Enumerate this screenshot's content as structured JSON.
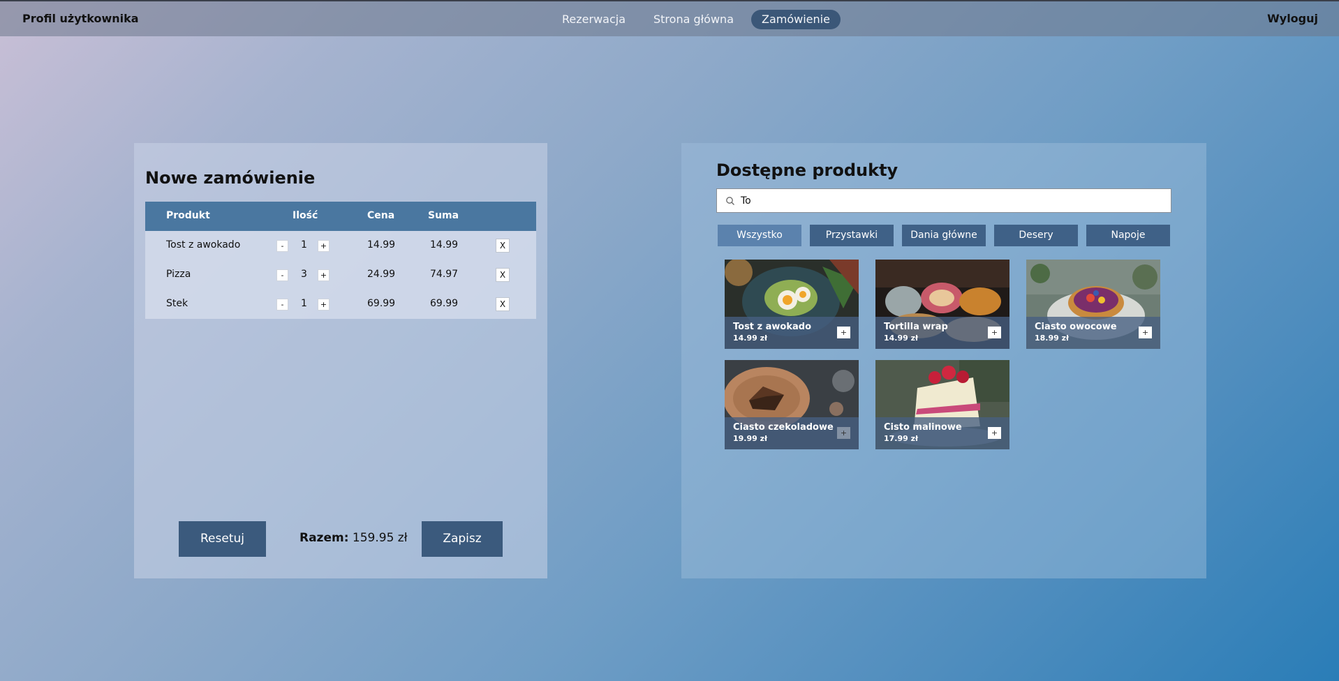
{
  "header": {
    "profile": "Profil użytkownika",
    "nav": [
      {
        "label": "Rezerwacja",
        "active": false
      },
      {
        "label": "Strona główna",
        "active": false
      },
      {
        "label": "Zamówienie",
        "active": true
      }
    ],
    "logout": "Wyloguj"
  },
  "order": {
    "title": "Nowe zamówienie",
    "columns": {
      "product": "Produkt",
      "qty": "Ilość",
      "price": "Cena",
      "sum": "Suma"
    },
    "rows": [
      {
        "product": "Tost z awokado",
        "qty": "1",
        "price": "14.99",
        "sum": "14.99"
      },
      {
        "product": "Pizza",
        "qty": "3",
        "price": "24.99",
        "sum": "74.97"
      },
      {
        "product": "Stek",
        "qty": "1",
        "price": "69.99",
        "sum": "69.99"
      }
    ],
    "minus": "-",
    "plus": "+",
    "remove": "X",
    "reset_label": "Resetuj",
    "total_label": "Razem:",
    "total_value": "159.95 zł",
    "save_label": "Zapisz"
  },
  "products": {
    "title": "Dostępne produkty",
    "search_value": "To",
    "filters": [
      "Wszystko",
      "Przystawki",
      "Dania główne",
      "Desery",
      "Napoje"
    ],
    "active_filter": "Wszystko",
    "add": "+",
    "items": [
      {
        "name": "Tost z awokado",
        "price": "14.99 zł",
        "icon": "avocado-toast-photo"
      },
      {
        "name": "Tortilla wrap",
        "price": "14.99 zł",
        "icon": "tortilla-wrap-photo"
      },
      {
        "name": "Ciasto owocowe",
        "price": "18.99 zł",
        "icon": "fruit-cake-photo"
      },
      {
        "name": "Ciasto czekoladowe",
        "price": "19.99 zł",
        "icon": "chocolate-cake-photo"
      },
      {
        "name": "Cisto malinowe",
        "price": "17.99 zł",
        "icon": "raspberry-cake-photo"
      }
    ]
  }
}
